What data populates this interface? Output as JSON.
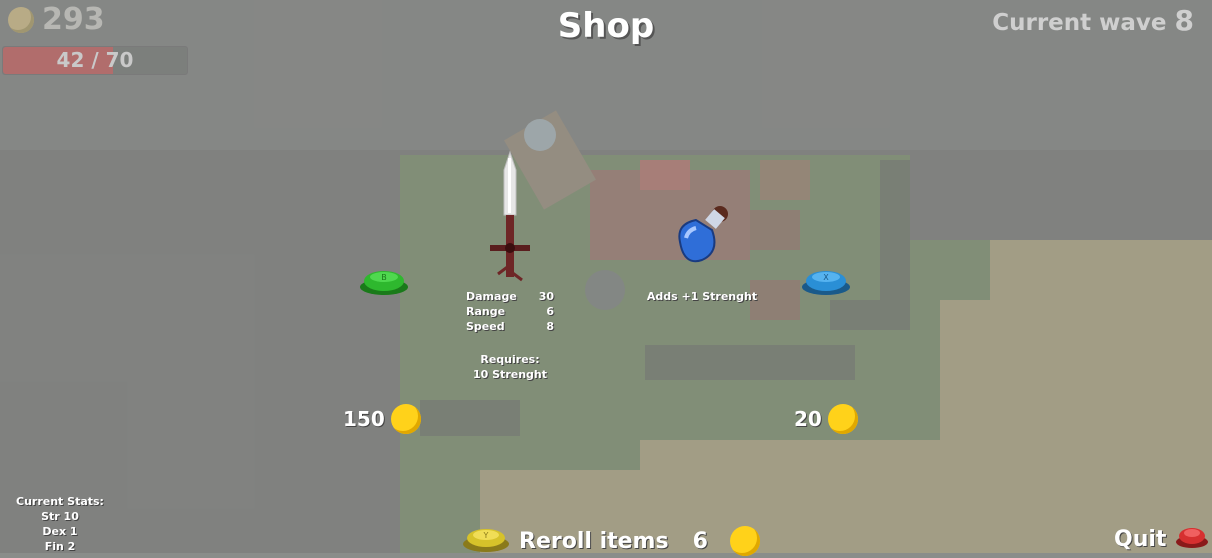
{
  "hud": {
    "coins": "293",
    "hp_text": "42 / 70",
    "hp_fraction": 0.6,
    "wave_label": "Current wave",
    "wave_number": "8"
  },
  "shop": {
    "title": "Shop",
    "left_item": {
      "icon": "sword-icon",
      "stats": [
        {
          "label": "Damage",
          "value": "30"
        },
        {
          "label": "Range",
          "value": "6"
        },
        {
          "label": "Speed",
          "value": "8"
        }
      ],
      "requires_label": "Requires:",
      "requires_value": "10 Strenght",
      "price": "150",
      "select_button_icon": "green-b-button-icon"
    },
    "right_item": {
      "icon": "blue-potion-icon",
      "description": "Adds +1 Strenght",
      "price": "20",
      "select_button_icon": "blue-x-button-icon"
    },
    "reroll": {
      "label": "Reroll items",
      "cost": "6",
      "button_icon": "yellow-y-button-icon"
    },
    "quit": {
      "label": "Quit",
      "button_icon": "red-b-button-icon"
    }
  },
  "current_stats": {
    "heading": "Current Stats:",
    "lines": [
      "Str 10",
      "Dex 1",
      "Fin 2"
    ]
  },
  "colors": {
    "coin": "#ffd21a",
    "hp_fill": "#b16d6c",
    "green_button": "#2eb82e",
    "blue_button": "#2a8fd6",
    "yellow_button": "#d6c22a",
    "red_button": "#d63030"
  }
}
